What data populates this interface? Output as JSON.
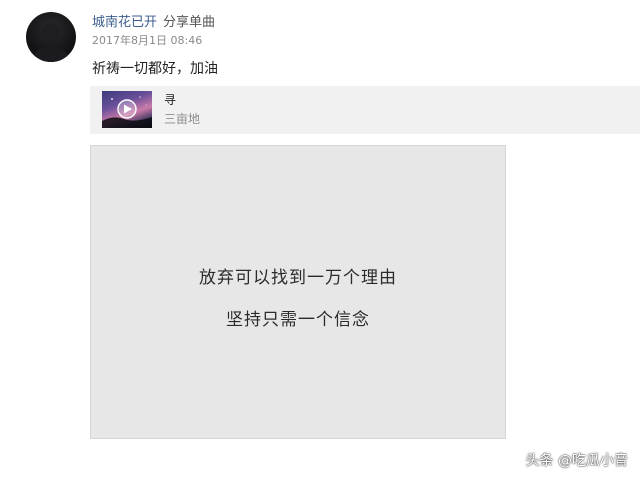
{
  "post": {
    "username": "城南花已开",
    "action": "分享单曲",
    "timestamp": "2017年8月1日 08:46",
    "text": "祈祷一切都好，加油"
  },
  "music": {
    "title": "寻",
    "artist": "三亩地",
    "cover_icon": "play-icon"
  },
  "image": {
    "line1": "放弃可以找到一万个理由",
    "line2": "坚持只需一个信念"
  },
  "watermark": "头条 @吃瓜小音",
  "colors": {
    "username": "#3a5d8f",
    "card_background": "#f1f1f1",
    "image_background": "#e7e7e7"
  }
}
